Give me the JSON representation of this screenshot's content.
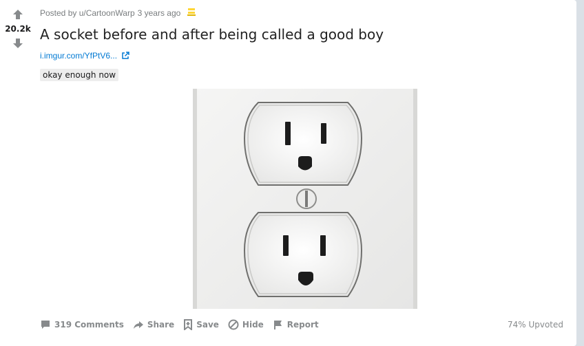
{
  "post": {
    "score": "20.2k",
    "posted_by": "Posted by u/CartoonWarp",
    "time_ago": "3 years ago",
    "title": "A socket before and after being called a good boy",
    "link_text": "i.imgur.com/YfPtV6...",
    "flair": "okay enough now",
    "upvote_ratio": "74% Upvoted"
  },
  "actions": {
    "comments": "319 Comments",
    "share": "Share",
    "save": "Save",
    "hide": "Hide",
    "report": "Report"
  },
  "icons": {
    "upvote": "arrow-up-icon",
    "downvote": "arrow-down-icon",
    "award": "award-icon",
    "external": "external-link-icon",
    "comment": "comment-icon",
    "share": "share-icon",
    "save": "bookmark-icon",
    "hide": "hide-icon",
    "report": "flag-icon"
  },
  "colors": {
    "link": "#0079d3",
    "muted": "#878a8c",
    "award": "#ffd635",
    "background": "#dae0e6"
  }
}
